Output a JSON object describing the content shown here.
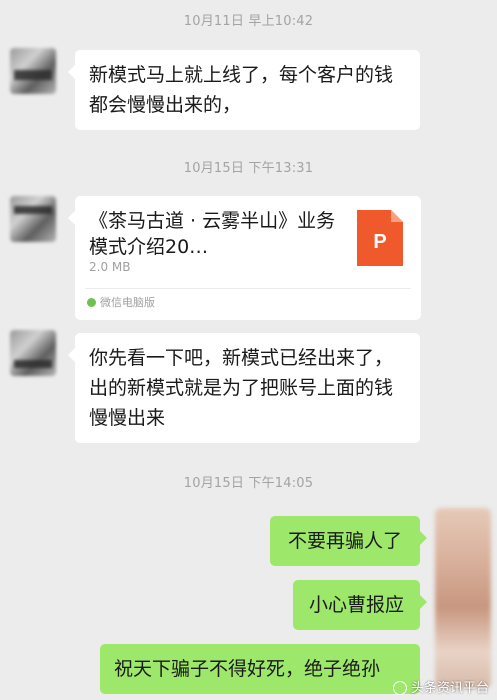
{
  "timestamps": [
    "10月11日 早上10:42",
    "10月15日 下午13:31",
    "10月15日 下午14:05"
  ],
  "messages": {
    "m1": "新模式马上就上线了，每个客户的钱都会慢慢出来的，",
    "m2": "你先看一下吧，新模式已经出来了，出的新模式就是为了把账号上面的钱慢慢出来",
    "r1": "不要再骗人了",
    "r2": "小心曹报应",
    "r3": "祝天下骗子不得好死，绝子绝孙"
  },
  "file": {
    "title": "《茶马古道 · 云雾半山》业务模式介绍20…",
    "size": "2.0 MB",
    "source": "微信电脑版",
    "icon_letter": "P",
    "icon_color": "#f0592b"
  },
  "watermark": "头条资讯平台",
  "colors": {
    "background": "#ececec",
    "bubble_in": "#ffffff",
    "bubble_out": "#9de86a",
    "timestamp": "#a3a3a3"
  }
}
